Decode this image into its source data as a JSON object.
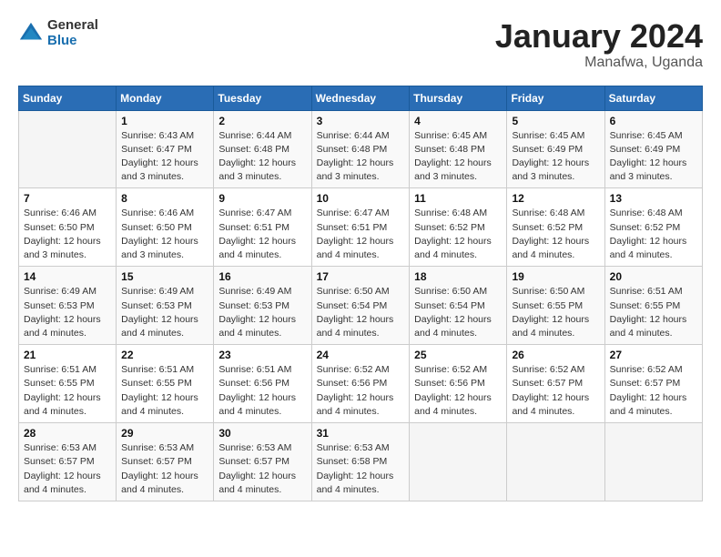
{
  "header": {
    "logo": {
      "general": "General",
      "blue": "Blue"
    },
    "title": "January 2024",
    "location": "Manafwa, Uganda"
  },
  "calendar": {
    "days_of_week": [
      "Sunday",
      "Monday",
      "Tuesday",
      "Wednesday",
      "Thursday",
      "Friday",
      "Saturday"
    ],
    "weeks": [
      [
        {
          "day": "",
          "sunrise": "",
          "sunset": "",
          "daylight": ""
        },
        {
          "day": "1",
          "sunrise": "Sunrise: 6:43 AM",
          "sunset": "Sunset: 6:47 PM",
          "daylight": "Daylight: 12 hours and 3 minutes."
        },
        {
          "day": "2",
          "sunrise": "Sunrise: 6:44 AM",
          "sunset": "Sunset: 6:48 PM",
          "daylight": "Daylight: 12 hours and 3 minutes."
        },
        {
          "day": "3",
          "sunrise": "Sunrise: 6:44 AM",
          "sunset": "Sunset: 6:48 PM",
          "daylight": "Daylight: 12 hours and 3 minutes."
        },
        {
          "day": "4",
          "sunrise": "Sunrise: 6:45 AM",
          "sunset": "Sunset: 6:48 PM",
          "daylight": "Daylight: 12 hours and 3 minutes."
        },
        {
          "day": "5",
          "sunrise": "Sunrise: 6:45 AM",
          "sunset": "Sunset: 6:49 PM",
          "daylight": "Daylight: 12 hours and 3 minutes."
        },
        {
          "day": "6",
          "sunrise": "Sunrise: 6:45 AM",
          "sunset": "Sunset: 6:49 PM",
          "daylight": "Daylight: 12 hours and 3 minutes."
        }
      ],
      [
        {
          "day": "7",
          "sunrise": "Sunrise: 6:46 AM",
          "sunset": "Sunset: 6:50 PM",
          "daylight": "Daylight: 12 hours and 3 minutes."
        },
        {
          "day": "8",
          "sunrise": "Sunrise: 6:46 AM",
          "sunset": "Sunset: 6:50 PM",
          "daylight": "Daylight: 12 hours and 3 minutes."
        },
        {
          "day": "9",
          "sunrise": "Sunrise: 6:47 AM",
          "sunset": "Sunset: 6:51 PM",
          "daylight": "Daylight: 12 hours and 4 minutes."
        },
        {
          "day": "10",
          "sunrise": "Sunrise: 6:47 AM",
          "sunset": "Sunset: 6:51 PM",
          "daylight": "Daylight: 12 hours and 4 minutes."
        },
        {
          "day": "11",
          "sunrise": "Sunrise: 6:48 AM",
          "sunset": "Sunset: 6:52 PM",
          "daylight": "Daylight: 12 hours and 4 minutes."
        },
        {
          "day": "12",
          "sunrise": "Sunrise: 6:48 AM",
          "sunset": "Sunset: 6:52 PM",
          "daylight": "Daylight: 12 hours and 4 minutes."
        },
        {
          "day": "13",
          "sunrise": "Sunrise: 6:48 AM",
          "sunset": "Sunset: 6:52 PM",
          "daylight": "Daylight: 12 hours and 4 minutes."
        }
      ],
      [
        {
          "day": "14",
          "sunrise": "Sunrise: 6:49 AM",
          "sunset": "Sunset: 6:53 PM",
          "daylight": "Daylight: 12 hours and 4 minutes."
        },
        {
          "day": "15",
          "sunrise": "Sunrise: 6:49 AM",
          "sunset": "Sunset: 6:53 PM",
          "daylight": "Daylight: 12 hours and 4 minutes."
        },
        {
          "day": "16",
          "sunrise": "Sunrise: 6:49 AM",
          "sunset": "Sunset: 6:53 PM",
          "daylight": "Daylight: 12 hours and 4 minutes."
        },
        {
          "day": "17",
          "sunrise": "Sunrise: 6:50 AM",
          "sunset": "Sunset: 6:54 PM",
          "daylight": "Daylight: 12 hours and 4 minutes."
        },
        {
          "day": "18",
          "sunrise": "Sunrise: 6:50 AM",
          "sunset": "Sunset: 6:54 PM",
          "daylight": "Daylight: 12 hours and 4 minutes."
        },
        {
          "day": "19",
          "sunrise": "Sunrise: 6:50 AM",
          "sunset": "Sunset: 6:55 PM",
          "daylight": "Daylight: 12 hours and 4 minutes."
        },
        {
          "day": "20",
          "sunrise": "Sunrise: 6:51 AM",
          "sunset": "Sunset: 6:55 PM",
          "daylight": "Daylight: 12 hours and 4 minutes."
        }
      ],
      [
        {
          "day": "21",
          "sunrise": "Sunrise: 6:51 AM",
          "sunset": "Sunset: 6:55 PM",
          "daylight": "Daylight: 12 hours and 4 minutes."
        },
        {
          "day": "22",
          "sunrise": "Sunrise: 6:51 AM",
          "sunset": "Sunset: 6:55 PM",
          "daylight": "Daylight: 12 hours and 4 minutes."
        },
        {
          "day": "23",
          "sunrise": "Sunrise: 6:51 AM",
          "sunset": "Sunset: 6:56 PM",
          "daylight": "Daylight: 12 hours and 4 minutes."
        },
        {
          "day": "24",
          "sunrise": "Sunrise: 6:52 AM",
          "sunset": "Sunset: 6:56 PM",
          "daylight": "Daylight: 12 hours and 4 minutes."
        },
        {
          "day": "25",
          "sunrise": "Sunrise: 6:52 AM",
          "sunset": "Sunset: 6:56 PM",
          "daylight": "Daylight: 12 hours and 4 minutes."
        },
        {
          "day": "26",
          "sunrise": "Sunrise: 6:52 AM",
          "sunset": "Sunset: 6:57 PM",
          "daylight": "Daylight: 12 hours and 4 minutes."
        },
        {
          "day": "27",
          "sunrise": "Sunrise: 6:52 AM",
          "sunset": "Sunset: 6:57 PM",
          "daylight": "Daylight: 12 hours and 4 minutes."
        }
      ],
      [
        {
          "day": "28",
          "sunrise": "Sunrise: 6:53 AM",
          "sunset": "Sunset: 6:57 PM",
          "daylight": "Daylight: 12 hours and 4 minutes."
        },
        {
          "day": "29",
          "sunrise": "Sunrise: 6:53 AM",
          "sunset": "Sunset: 6:57 PM",
          "daylight": "Daylight: 12 hours and 4 minutes."
        },
        {
          "day": "30",
          "sunrise": "Sunrise: 6:53 AM",
          "sunset": "Sunset: 6:57 PM",
          "daylight": "Daylight: 12 hours and 4 minutes."
        },
        {
          "day": "31",
          "sunrise": "Sunrise: 6:53 AM",
          "sunset": "Sunset: 6:58 PM",
          "daylight": "Daylight: 12 hours and 4 minutes."
        },
        {
          "day": "",
          "sunrise": "",
          "sunset": "",
          "daylight": ""
        },
        {
          "day": "",
          "sunrise": "",
          "sunset": "",
          "daylight": ""
        },
        {
          "day": "",
          "sunrise": "",
          "sunset": "",
          "daylight": ""
        }
      ]
    ]
  }
}
